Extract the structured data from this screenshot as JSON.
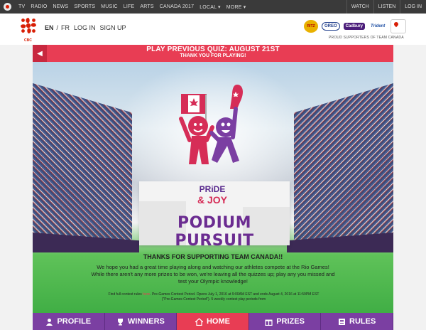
{
  "topnav": {
    "links": [
      "TV",
      "RADIO",
      "NEWS",
      "SPORTS",
      "MUSIC",
      "LIFE",
      "ARTS",
      "CANADA 2017",
      "LOCAL ▾",
      "MORE ▾"
    ],
    "right": [
      "WATCH",
      "LISTEN",
      "LOG IN"
    ]
  },
  "header": {
    "logo_text": "CBC",
    "lang_en": "EN",
    "lang_sep": "/",
    "lang_fr": "FR",
    "login": "LOG IN",
    "signup": "SIGN UP",
    "sponsors": [
      "RITZ",
      "OREO",
      "Cadbury",
      "Trident"
    ],
    "sponsor_label": "PROUD SUPPORTERS OF TEAM CANADA"
  },
  "banner": {
    "back_icon": "◀",
    "title": "PLAY PREVIOUS QUIZ: AUGUST 21ST",
    "subtitle": "THANK YOU FOR PLAYING!"
  },
  "brand": {
    "line1": "PRiDE",
    "line2": "& JOY"
  },
  "game": {
    "title": "PODIUM PURSUIT"
  },
  "info": {
    "heading": "THANKS FOR SUPPORTING TEAM CANADA!!",
    "body": "We hope you had a great time playing along and watching our athletes compete at the Rio Games! While there aren't any more prizes to be won, we're leaving all the quizzes up; play any you missed and test your Olympic knowledge!"
  },
  "rules": {
    "prefix": "Find full contest rules",
    "link": "here",
    "text": ". Pre-Games Contest Period. Opens July 1, 2016 at 9:00AM EST and ends August 4, 2016 at 11:59PM EST (\"Pre-Games Contest Period\"). 5 weekly contest play periods from"
  },
  "tabs": [
    {
      "label": "PROFILE",
      "icon": "user-icon"
    },
    {
      "label": "WINNERS",
      "icon": "trophy-icon"
    },
    {
      "label": "HOME",
      "icon": "home-icon"
    },
    {
      "label": "PRIZES",
      "icon": "gift-icon"
    },
    {
      "label": "RULES",
      "icon": "rules-icon"
    }
  ],
  "colors": {
    "accent": "#e83d54",
    "tab_purple": "#7b3fa2",
    "title_purple": "#6b2c91"
  }
}
